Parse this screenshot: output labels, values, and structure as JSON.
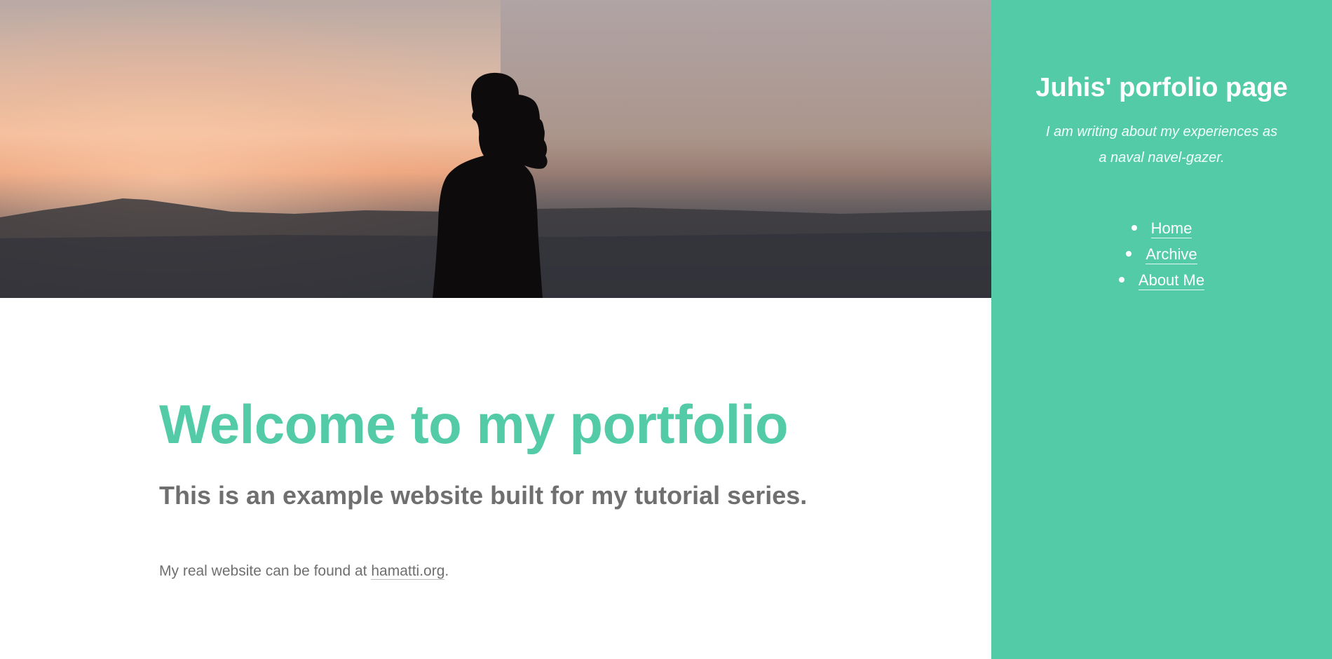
{
  "colors": {
    "accent": "#52cba6",
    "text_gray": "#6f6f6f",
    "sidebar_text": "#ffffff"
  },
  "hero": {
    "image": "silhouette-at-sunset-photo"
  },
  "main": {
    "headline": "Welcome to my portfolio",
    "subheadline": "This is an example website built for my tutorial series.",
    "body_prefix": "My real website can be found at ",
    "body_link": "hamatti.org",
    "body_suffix": "."
  },
  "sidebar": {
    "title": "Juhis' porfolio page",
    "tagline": "I am writing about my experiences as a naval navel-gazer.",
    "nav": [
      {
        "label": "Home"
      },
      {
        "label": "Archive"
      },
      {
        "label": "About Me"
      }
    ]
  }
}
